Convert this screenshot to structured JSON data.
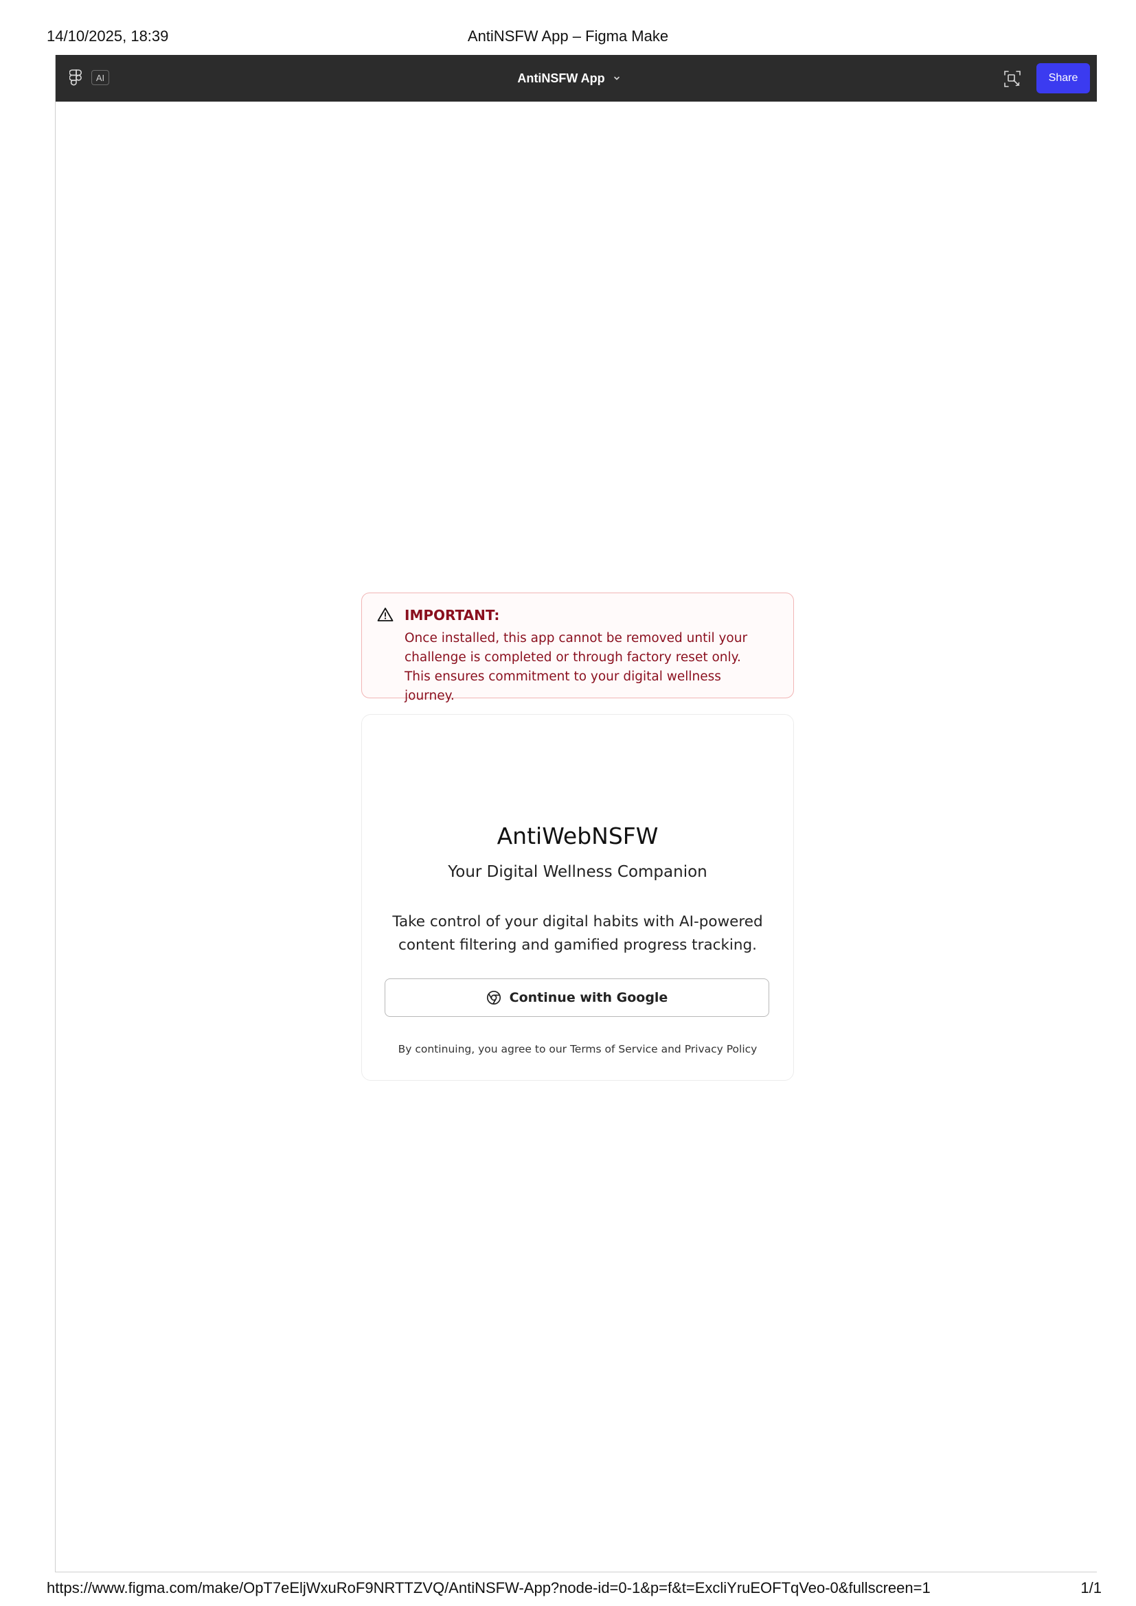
{
  "print": {
    "date": "14/10/2025, 18:39",
    "title": "AntiNSFW App – Figma Make",
    "url": "https://www.figma.com/make/OpT7eEljWxuRoF9NRTTZVQ/AntiNSFW-App?node-id=0-1&p=f&t=ExcliYruEOFTqVeo-0&fullscreen=1",
    "page": "1/1"
  },
  "topbar": {
    "logo_icon": "figma-logo-icon",
    "ai_badge": "AI",
    "app_title": "AntiNSFW App",
    "chevron_icon": "chevron-down-icon",
    "present_icon": "present-icon",
    "share_label": "Share",
    "bg_color": "#2c2c2c",
    "share_color": "#3b3bf0"
  },
  "warning": {
    "icon": "warning-triangle-icon",
    "heading": "IMPORTANT:",
    "body": "Once installed, this app cannot be removed until your challenge is completed or through factory reset only. This ensures commitment to your digital wellness journey.",
    "color": "#8a0f1e"
  },
  "card": {
    "title": "AntiWebNSFW",
    "subtitle": "Your Digital Wellness Companion",
    "description": "Take control of your digital habits with AI-powered content filtering and gamified progress tracking.",
    "google_button": {
      "icon": "chrome-icon",
      "label": "Continue with Google"
    },
    "legal": "By continuing, you agree to our Terms of Service and Privacy Policy"
  }
}
